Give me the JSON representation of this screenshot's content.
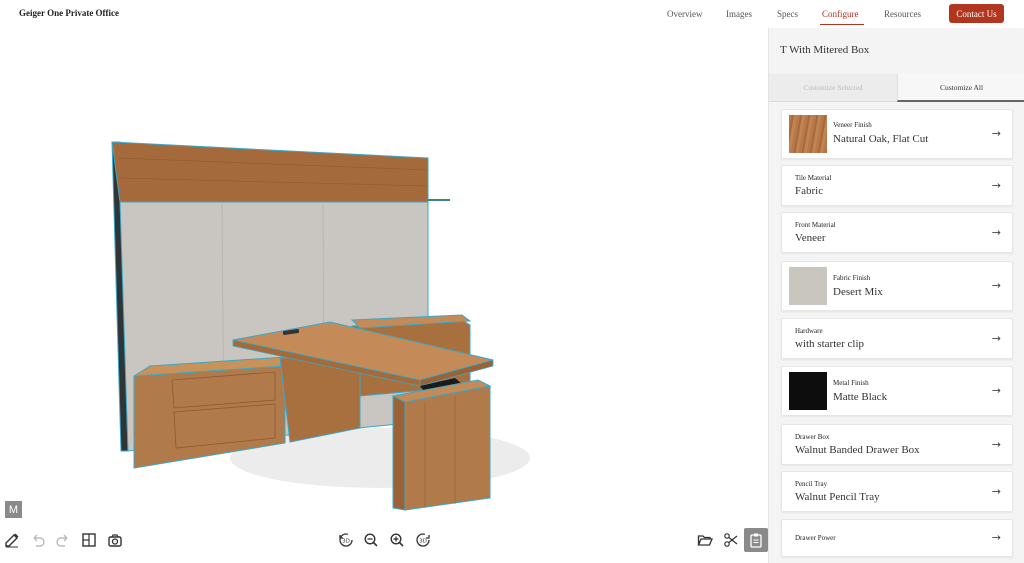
{
  "header": {
    "brand": "Geiger One Private Office",
    "nav": [
      {
        "label": "Overview",
        "active": false
      },
      {
        "label": "Images",
        "active": false
      },
      {
        "label": "Specs",
        "active": false
      },
      {
        "label": "Configure",
        "active": true
      },
      {
        "label": "Resources",
        "active": false
      }
    ],
    "contact_label": "Contact Us"
  },
  "viewport": {
    "badge": "M",
    "tools_left": [
      "edit-icon",
      "undo-icon",
      "redo-icon",
      "layout-icon",
      "camera-icon"
    ],
    "tools_center": [
      "rotate-left-icon",
      "zoom-out-icon",
      "zoom-in-icon",
      "rotate-right-icon"
    ],
    "tools_right": [
      "folder-icon",
      "share-icon",
      "clipboard-icon"
    ]
  },
  "panel": {
    "title": "T With Mitered Box",
    "tabs": {
      "selected": "Customize Selected",
      "all": "Customize All"
    },
    "options": [
      {
        "label": "Veneer Finish",
        "value": "Natural Oak, Flat Cut",
        "swatch": "#b5794a"
      },
      {
        "label": "Tile Material",
        "value": "Fabric"
      },
      {
        "label": "Front Material",
        "value": "Veneer"
      },
      {
        "label": "Fabric Finish",
        "value": "Desert Mix",
        "swatch": "#c9c5bf"
      },
      {
        "label": "Hardware",
        "value": "with starter clip"
      },
      {
        "label": "Metal Finish",
        "value": "Matte Black",
        "swatch": "#0d0d0d"
      },
      {
        "label": "Drawer Box",
        "value": "Walnut Banded Drawer Box"
      },
      {
        "label": "Pencil Tray",
        "value": "Walnut Pencil Tray"
      },
      {
        "label": "Drawer Power",
        "value": ""
      }
    ]
  },
  "colors": {
    "accent": "#b0361f",
    "wood": "#b07a4a",
    "panel_fabric": "#c9c6c1",
    "outline": "#3aa8c8"
  }
}
